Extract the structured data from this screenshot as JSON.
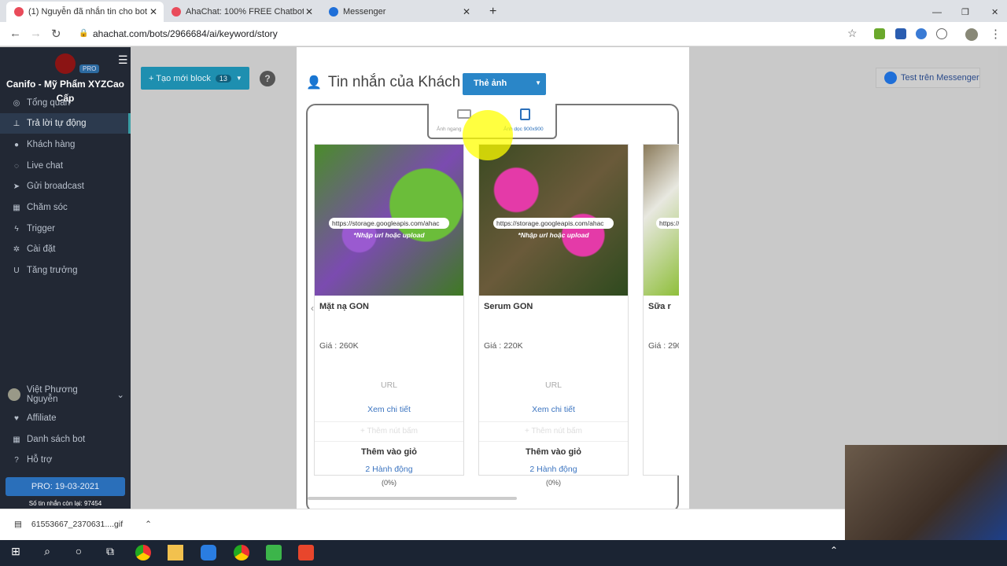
{
  "browser": {
    "tabs": [
      {
        "title": "(1) Nguyễn đã nhắn tin cho bot"
      },
      {
        "title": "AhaChat: 100% FREE Chatbot M..."
      },
      {
        "title": "Messenger"
      }
    ],
    "new_tab": "+",
    "url": "ahachat.com/bots/2966684/ai/keyword/story"
  },
  "sidebar": {
    "bot_name": "Canifo - Mỹ Phẩm XYZCao Cấp",
    "pro_badge": "PRO",
    "items": [
      {
        "label": "Tổng quan",
        "icon": "dashboard"
      },
      {
        "label": "Trả lời tự động",
        "icon": "sitemap"
      },
      {
        "label": "Khách hàng",
        "icon": "user"
      },
      {
        "label": "Live chat",
        "icon": "comment"
      },
      {
        "label": "Gửi broadcast",
        "icon": "paper-plane"
      },
      {
        "label": "Chăm sóc",
        "icon": "calendar"
      },
      {
        "label": "Trigger",
        "icon": "bolt"
      },
      {
        "label": "Cài đặt",
        "icon": "gear"
      },
      {
        "label": "Tăng trưởng",
        "icon": "magnet"
      }
    ],
    "user": "Việt Phương Nguyễn",
    "bottom_items": [
      {
        "label": "Affiliate"
      },
      {
        "label": "Danh sách bot"
      },
      {
        "label": "Hỗ trợ"
      }
    ],
    "pro_until": "PRO: 19-03-2021",
    "remaining": "Số tin nhắn còn lại: 97454"
  },
  "toolbar": {
    "new_block": "+ Tạo mới block",
    "block_count": "13",
    "help": "?"
  },
  "test_messenger": "Test trên Messenger",
  "editor": {
    "title": "Tin nhắn của Khách",
    "type_select": "Thẻ ảnh",
    "orientation": {
      "horizontal": "Ảnh ngang",
      "vertical": "Ảnh dọc 900x900"
    },
    "cards": [
      {
        "image_url": "https://storage.googleapis.com/ahac",
        "upload_hint": "*Nhập url hoặc upload",
        "name": "Mặt nạ GON",
        "price": "Giá : 260K",
        "url": "URL",
        "detail": "Xem chi tiết",
        "add_button": "+ Thêm nút bấm",
        "cart": "Thêm vào giỏ",
        "actions": "2 Hành động",
        "percent": "(0%)"
      },
      {
        "image_url": "https://storage.googleapis.com/ahac",
        "upload_hint": "*Nhập url hoặc upload",
        "name": "Serum GON",
        "price": "Giá : 220K",
        "url": "URL",
        "detail": "Xem chi tiết",
        "add_button": "+ Thêm nút bấm",
        "cart": "Thêm vào giỏ",
        "actions": "2 Hành động",
        "percent": "(0%)"
      },
      {
        "image_url": "https://s",
        "name": "Sữa r",
        "price": "Giá : 290"
      }
    ]
  },
  "download": {
    "file": "61553667_2370631....gif"
  }
}
